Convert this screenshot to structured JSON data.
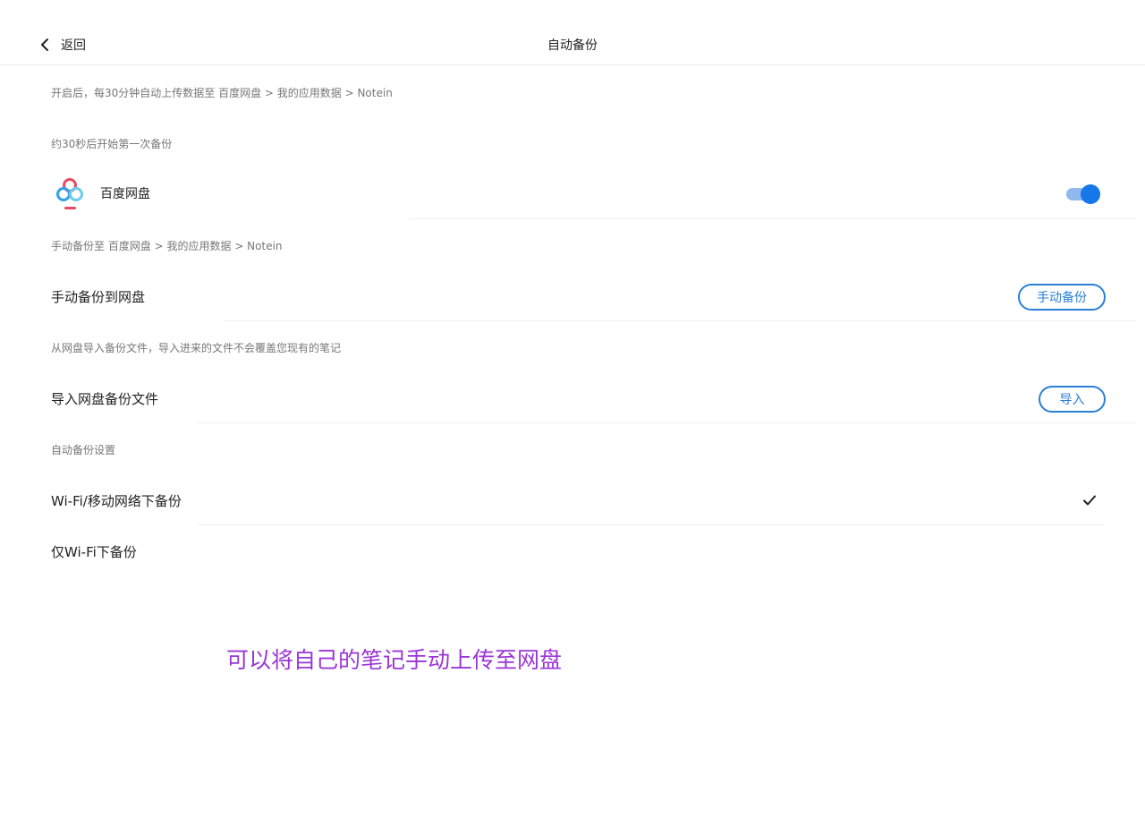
{
  "header": {
    "back_label": "返回",
    "title": "自动备份"
  },
  "auto_backup": {
    "description": "开启后，每30分钟自动上传数据至 百度网盘 > 我的应用数据 > Notein",
    "first_backup_hint": "约30秒后开始第一次备份",
    "service_name": "百度网盘",
    "enabled": true
  },
  "manual_backup": {
    "description": "手动备份至 百度网盘 > 我的应用数据 > Notein",
    "row_label": "手动备份到网盘",
    "button_label": "手动备份"
  },
  "import_backup": {
    "description": "从网盘导入备份文件，导入进来的文件不会覆盖您现有的笔记",
    "row_label": "导入网盘备份文件",
    "button_label": "导入"
  },
  "settings": {
    "section_label": "自动备份设置",
    "options": [
      {
        "label": "Wi-Fi/移动网络下备份",
        "selected": true
      },
      {
        "label": "仅Wi-Fi下备份",
        "selected": false
      }
    ]
  },
  "overlay": {
    "caption": "可以将自己的笔记手动上传至网盘"
  },
  "colors": {
    "accent": "#1677e8",
    "button_border": "#2a7fd6",
    "caption": "#9b35d6"
  }
}
